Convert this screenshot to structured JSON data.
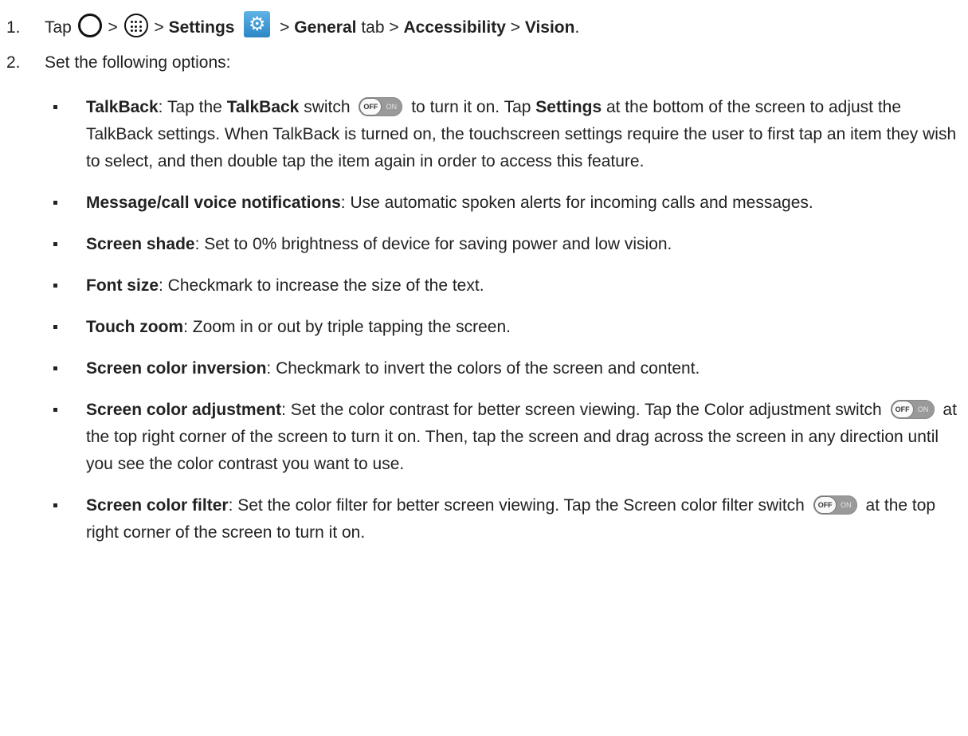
{
  "step1": {
    "num": "1.",
    "tap": "Tap",
    "sep": ">",
    "settings": "Settings",
    "general": "General",
    "tab": "tab",
    "accessibility": "Accessibility",
    "vision": "Vision",
    "end": "."
  },
  "step2": {
    "num": "2.",
    "text": "Set the following options:"
  },
  "switch": {
    "off": "OFF",
    "on": "ON"
  },
  "items": {
    "talkback": {
      "title": "TalkBack",
      "p1": ": Tap the ",
      "b1": "TalkBack",
      "p2": " switch",
      "p3": " to turn it on. Tap ",
      "b2": "Settings",
      "p4": " at the bottom of the screen to adjust the TalkBack settings. When TalkBack is turned on, the touchscreen settings require the user to first tap an item they wish to select, and then double tap the item again in order to access this feature."
    },
    "voice": {
      "title": "Message/call voice notifications",
      "text": ": Use automatic spoken alerts for incoming calls and messages."
    },
    "shade": {
      "title": "Screen shade",
      "text": ": Set to 0% brightness of device for saving power and low vision."
    },
    "font": {
      "title": "Font size",
      "text": ": Checkmark to increase the size of the text."
    },
    "zoom": {
      "title": "Touch zoom",
      "text": ": Zoom in or out by triple tapping the screen."
    },
    "inversion": {
      "title": "Screen color inversion",
      "text": ": Checkmark to invert the colors of the screen and content."
    },
    "adjust": {
      "title": "Screen color adjustment",
      "p1": ": Set the color contrast for better screen viewing. Tap the Color adjustment switch",
      "p2": " at the top right corner of the screen to turn it on. Then, tap the screen and drag across the screen in any direction until you see the color contrast you want to use."
    },
    "filter": {
      "title": "Screen color filter",
      "p1": ": Set the color filter for better screen viewing. Tap the Screen color filter switch",
      "p2": " at the top right corner of the screen to turn it on."
    }
  }
}
